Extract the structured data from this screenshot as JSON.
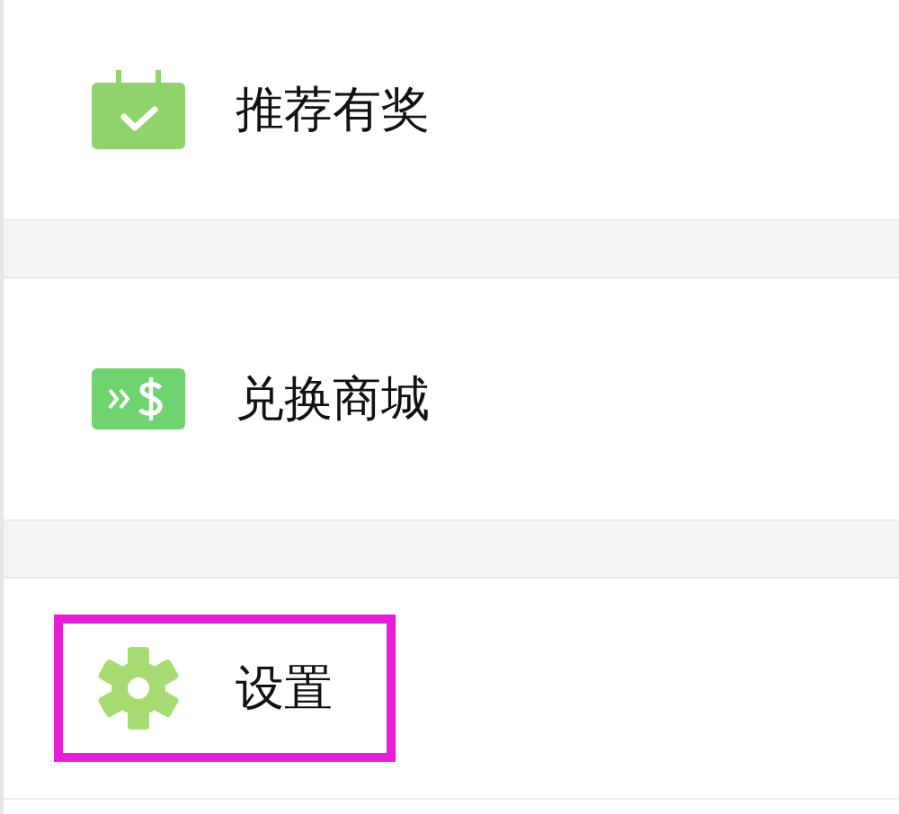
{
  "items": [
    {
      "kind": "calendar",
      "label": "推荐有奖",
      "highlighted": false
    },
    {
      "kind": "exchange",
      "label": "兑换商城",
      "highlighted": false
    },
    {
      "kind": "gear",
      "label": "设置",
      "highlighted": true
    }
  ]
}
